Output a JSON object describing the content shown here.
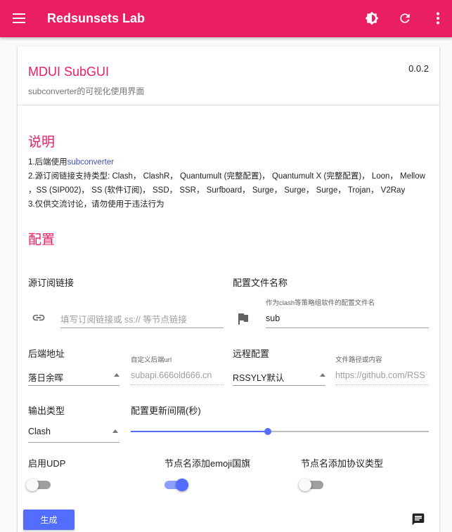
{
  "appbar": {
    "title": "Redsunsets Lab",
    "menu_icon": "menu-icon",
    "theme_icon": "brightness-icon",
    "refresh_icon": "refresh-icon",
    "more_icon": "more-vert-icon",
    "color": "#e91e63"
  },
  "card": {
    "title": "MDUI SubGUI",
    "subtitle": "subconverter的可视化使用界面",
    "version": "0.0.2"
  },
  "instructions": {
    "title": "说明",
    "line1_prefix": "1.后端使用",
    "line1_link": "subconverter",
    "line2": "2.源订阅链接支持类型: Clash， ClashR， Quantumult (完整配置)， Quantumult X (完整配置)， Loon， Mellow",
    "line3": "，SS (SIP002)， SS (软件订阅)， SSD， SSR， Surfboard， Surge， Surge， Surge， Trojan， V2Ray",
    "line4": "3.仅供交流讨论，请勿使用于违法行为"
  },
  "config": {
    "title": "配置",
    "source": {
      "label": "源订阅链接",
      "placeholder": "填写订阅链接或 ss:// 等节点链接",
      "icon": "link-icon"
    },
    "filename": {
      "label": "配置文件名称",
      "hint": "作为clash等策略组软件的配置文件名",
      "value": "sub",
      "icon": "flag-icon"
    },
    "backend": {
      "label": "后端地址",
      "value": "落日余晖",
      "custom_hint": "自定义后端url",
      "custom_placeholder": "subapi.666old666.cn"
    },
    "remote": {
      "label": "远程配置",
      "value": "RSSYLY默认",
      "path_hint": "文件路径或内容",
      "path_placeholder": "https://github.com/RSS"
    },
    "output": {
      "label": "输出类型",
      "value": "Clash"
    },
    "interval": {
      "label": "配置更新间隔(秒)",
      "level": 0.5
    },
    "udp": {
      "label": "启用UDP",
      "on": false
    },
    "emoji": {
      "label": "节点名添加emoji国旗",
      "on": true
    },
    "protocol": {
      "label": "节点名添加协议类型",
      "on": false
    }
  },
  "actions": {
    "generate": "生成",
    "chat_icon": "chat-icon",
    "accent": "#536dfe"
  }
}
